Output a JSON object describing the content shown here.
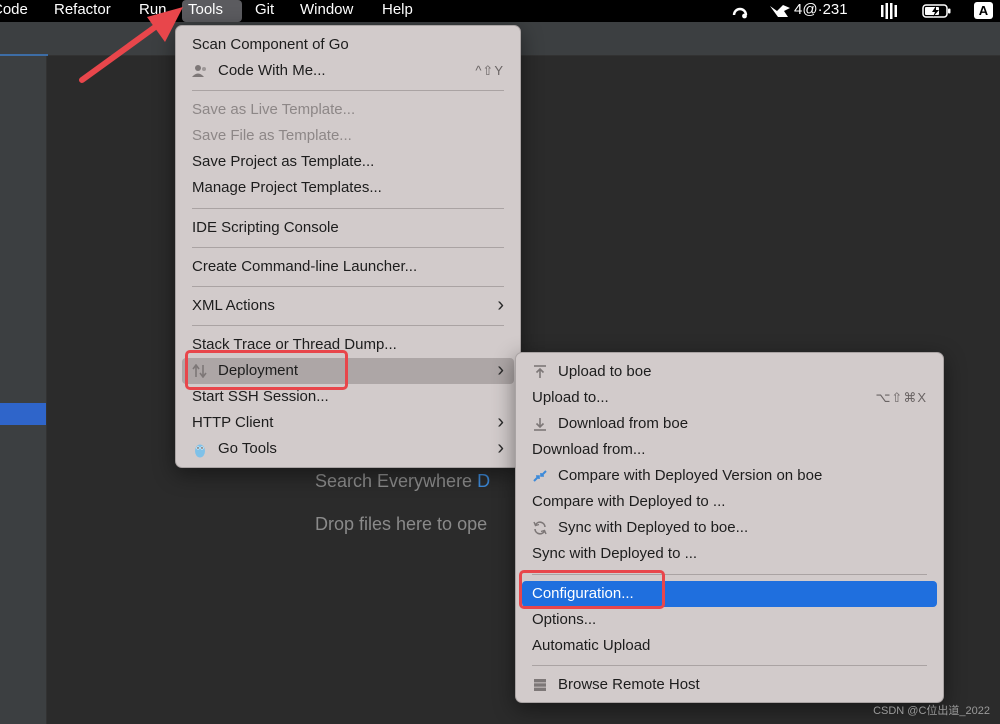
{
  "menubar": {
    "items": [
      "Code",
      "Refactor",
      "Run",
      "Tools",
      "Git",
      "Window",
      "Help"
    ],
    "status_text": "4@·231",
    "input_indicator": "A"
  },
  "editor": {
    "hint_search": "Search Everywhere",
    "hint_search_key": "D",
    "hint_drop": "Drop files here to ope"
  },
  "tools_menu": {
    "scan_component": "Scan Component of Go",
    "code_with_me": "Code With Me...",
    "code_with_me_shortcut": "^⇧Y",
    "save_live_template": "Save as Live Template...",
    "save_file_template": "Save File as Template...",
    "save_project_template": "Save Project as Template...",
    "manage_project_templates": "Manage Project Templates...",
    "ide_scripting_console": "IDE Scripting Console",
    "create_launcher": "Create Command-line Launcher...",
    "xml_actions": "XML Actions",
    "stack_trace": "Stack Trace or Thread Dump...",
    "deployment": "Deployment",
    "start_ssh": "Start SSH Session...",
    "http_client": "HTTP Client",
    "go_tools": "Go Tools"
  },
  "deploy_menu": {
    "upload_to_boe": "Upload to boe",
    "upload_to": "Upload to...",
    "upload_to_shortcut": "⌥⇧⌘X",
    "download_from_boe": "Download from boe",
    "download_from": "Download from...",
    "compare_boe": "Compare with Deployed Version on boe",
    "compare_to": "Compare with Deployed to ...",
    "sync_boe": "Sync with Deployed to boe...",
    "sync_to": "Sync with Deployed to ...",
    "configuration": "Configuration...",
    "options": "Options...",
    "automatic_upload": "Automatic Upload",
    "browse_remote": "Browse Remote Host"
  },
  "watermark": "CSDN @C位出道_2022",
  "colors": {
    "selection": "#1f6fde",
    "annotation": "#e8464b",
    "menu_bg": "#d2cbcb"
  }
}
